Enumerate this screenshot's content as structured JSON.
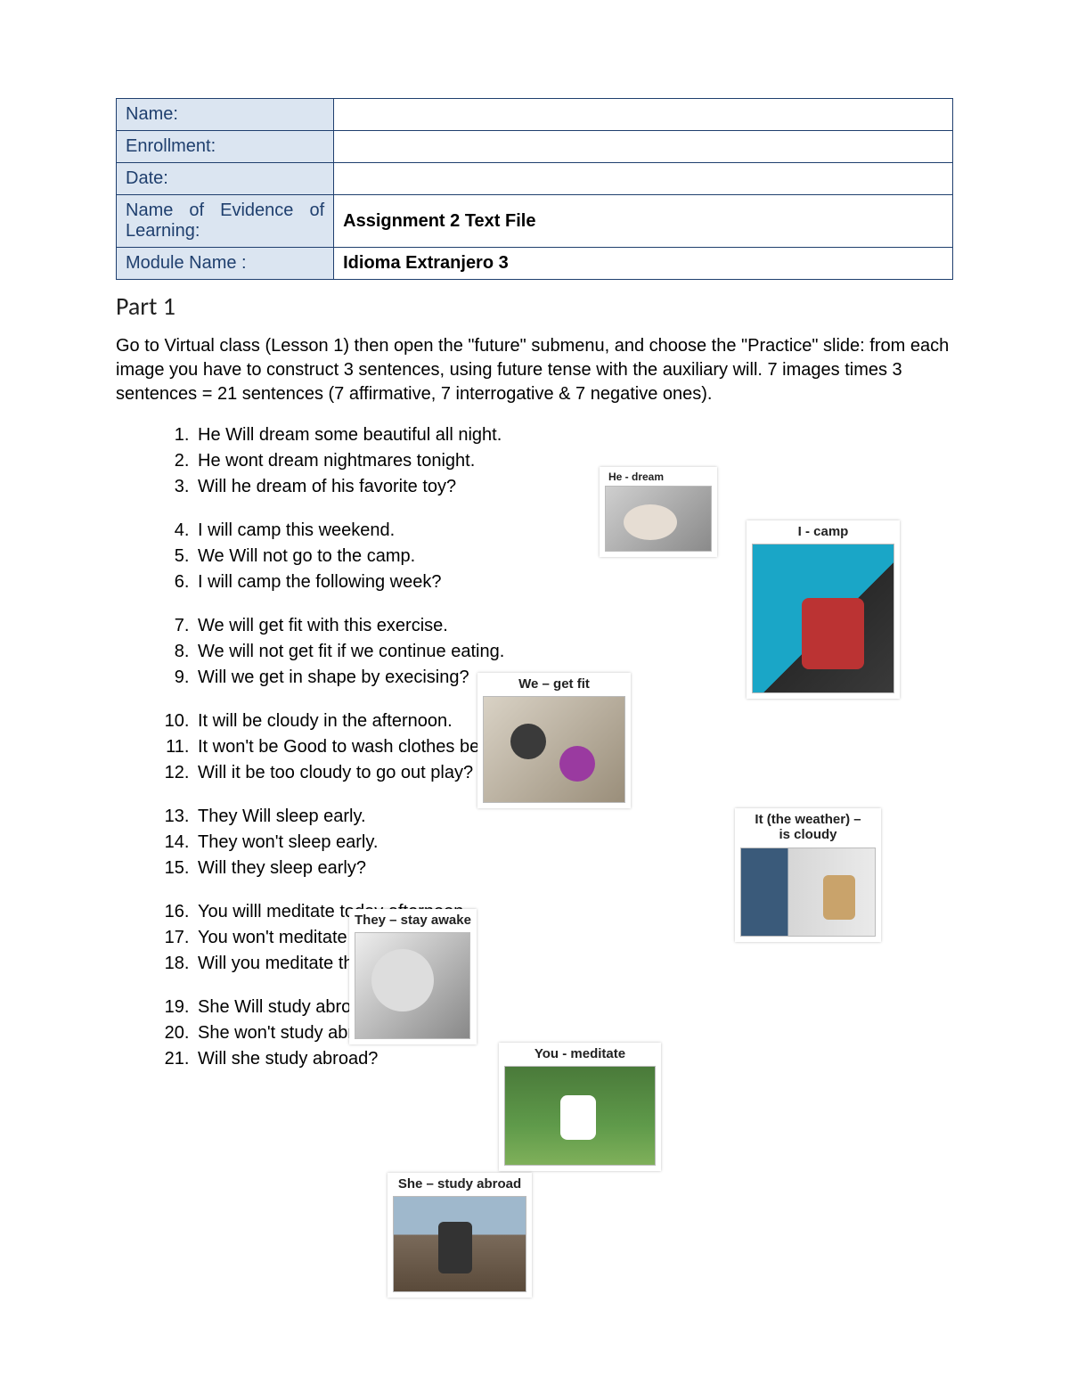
{
  "info_table": {
    "rows": [
      {
        "label": "Name:",
        "value": ""
      },
      {
        "label": "Enrollment:",
        "value": ""
      },
      {
        "label": "Date:",
        "value": ""
      },
      {
        "label": "Name of Evidence of Learning:",
        "value": "Assignment 2 Text File",
        "justify": true
      },
      {
        "label": "Module Name :",
        "value": "Idioma Extranjero 3"
      }
    ]
  },
  "part_heading": "Part 1",
  "instructions": "Go to Virtual class (Lesson 1) then open the \"future\" submenu, and choose the \"Practice\" slide: from each image you have to construct 3 sentences, using future tense with the auxiliary will. 7 images times 3 sentences = 21 sentences (7 affirmative, 7 interrogative & 7 negative ones).",
  "sentences": [
    "He Will dream some beautiful all night.",
    "He wont dream nightmares tonight.",
    "Will he dream of his favorite toy?",
    "I will camp this weekend.",
    "We Will not go to the camp.",
    "I will camp the following week?",
    "We will get fit with this exercise.",
    "We will not get fit if we continue eating.",
    "Will we get in shape by execising?",
    "It will be cloudy in the afternoon.",
    "It won't be Good to wash clothes because it is cloudy.",
    "Will it be too cloudy to go out play?",
    "They Will sleep early.",
    "They won't sleep early.",
    "Will they sleep early?",
    "You willl meditate today afternoon",
    "You won't meditate tody ofternoon",
    "Will you meditate this afternoon?",
    "She Will study abroad",
    "She won't study abroad",
    "Will she study abroad?"
  ],
  "cards": {
    "dream": {
      "caption": "He - dream"
    },
    "camp": {
      "caption": "I - camp"
    },
    "fit": {
      "caption": "We – get fit"
    },
    "cloudy": {
      "caption_line1": "It (the weather) –",
      "caption_line2": "is cloudy"
    },
    "awake": {
      "caption": "They – stay awake"
    },
    "meditate": {
      "caption": "You - meditate"
    },
    "abroad": {
      "caption": "She – study abroad"
    }
  }
}
